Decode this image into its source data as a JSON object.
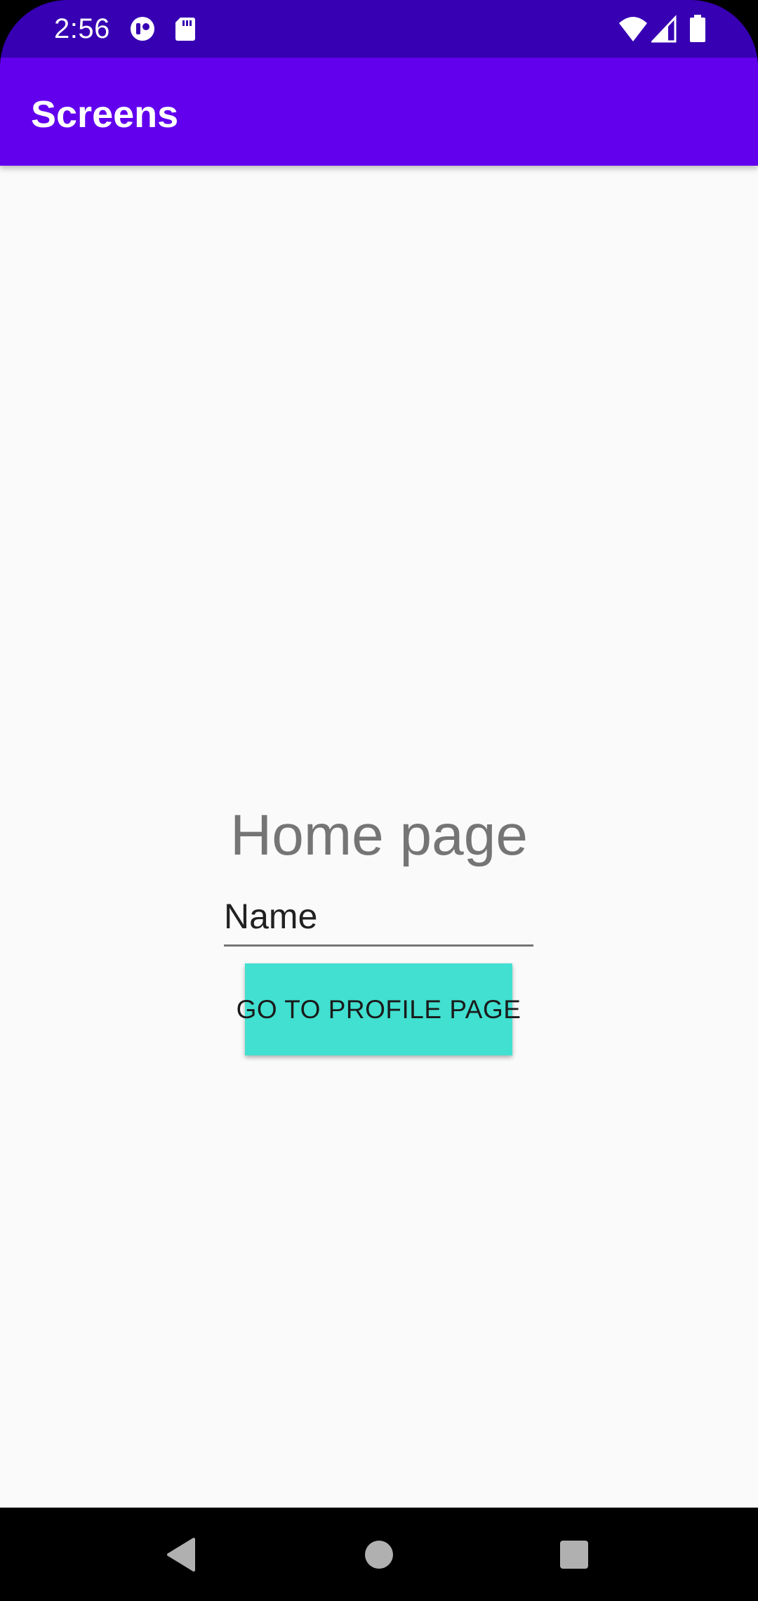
{
  "status_bar": {
    "time": "2:56",
    "left_icons": [
      "notification-app-icon",
      "sd-card-icon"
    ],
    "right_icons": [
      "wifi-icon",
      "cell-signal-icon",
      "battery-icon"
    ],
    "background_color": "#3700B3"
  },
  "app_bar": {
    "title": "Screens",
    "background_color": "#6200EE"
  },
  "main": {
    "heading": "Home page",
    "name_field": {
      "value": "Name"
    },
    "profile_button": {
      "label": "GO TO PROFILE PAGE",
      "background_color": "#41E0D0"
    }
  },
  "nav_bar": {
    "buttons": [
      "back-icon",
      "home-icon",
      "recents-icon"
    ]
  }
}
